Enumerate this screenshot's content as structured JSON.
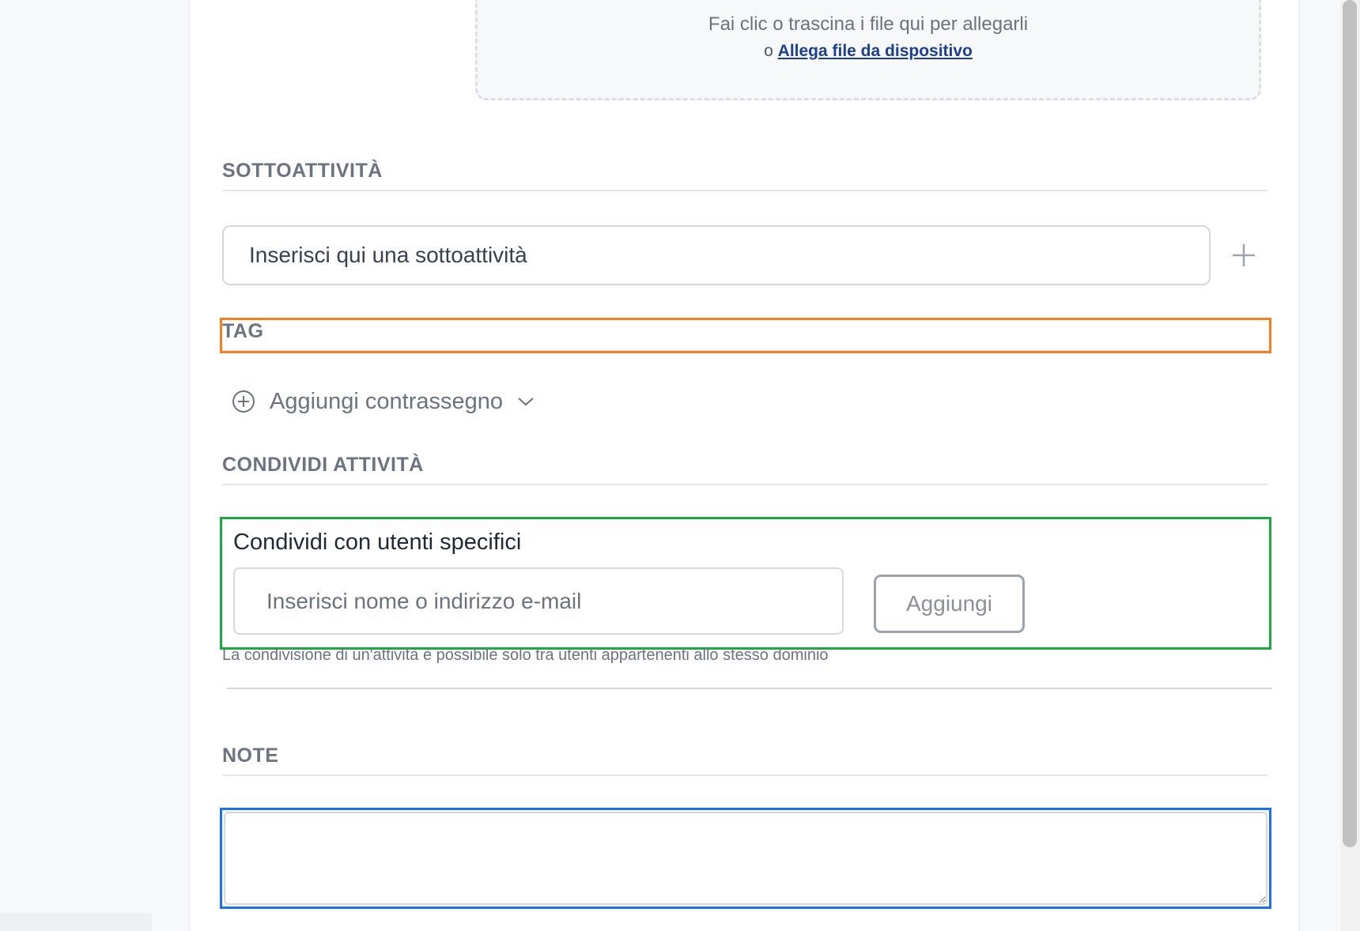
{
  "dropzone": {
    "text": "Fai clic o trascina i file qui per allegarli",
    "or": "o",
    "link": "Allega file da dispositivo"
  },
  "subtasks": {
    "header": "SOTTOATTIVITÀ",
    "input_value": "Inserisci qui una sottoattività"
  },
  "tag": {
    "header": "TAG",
    "add_label": "Aggiungi contrassegno"
  },
  "share": {
    "header": "CONDIVIDI ATTIVITÀ",
    "label": "Condividi con utenti specifici",
    "input_placeholder": "Inserisci nome o indirizzo e-mail",
    "add_button": "Aggiungi",
    "hint": "La condivisione di un'attività è possibile solo tra utenti appartenenti allo stesso dominio"
  },
  "notes": {
    "header": "NOTE",
    "value": ""
  },
  "colors": {
    "highlight_tag": "#f57f1f",
    "highlight_share": "#1aab3f",
    "highlight_notes": "#1b72e8",
    "link": "#1c3f8f"
  }
}
